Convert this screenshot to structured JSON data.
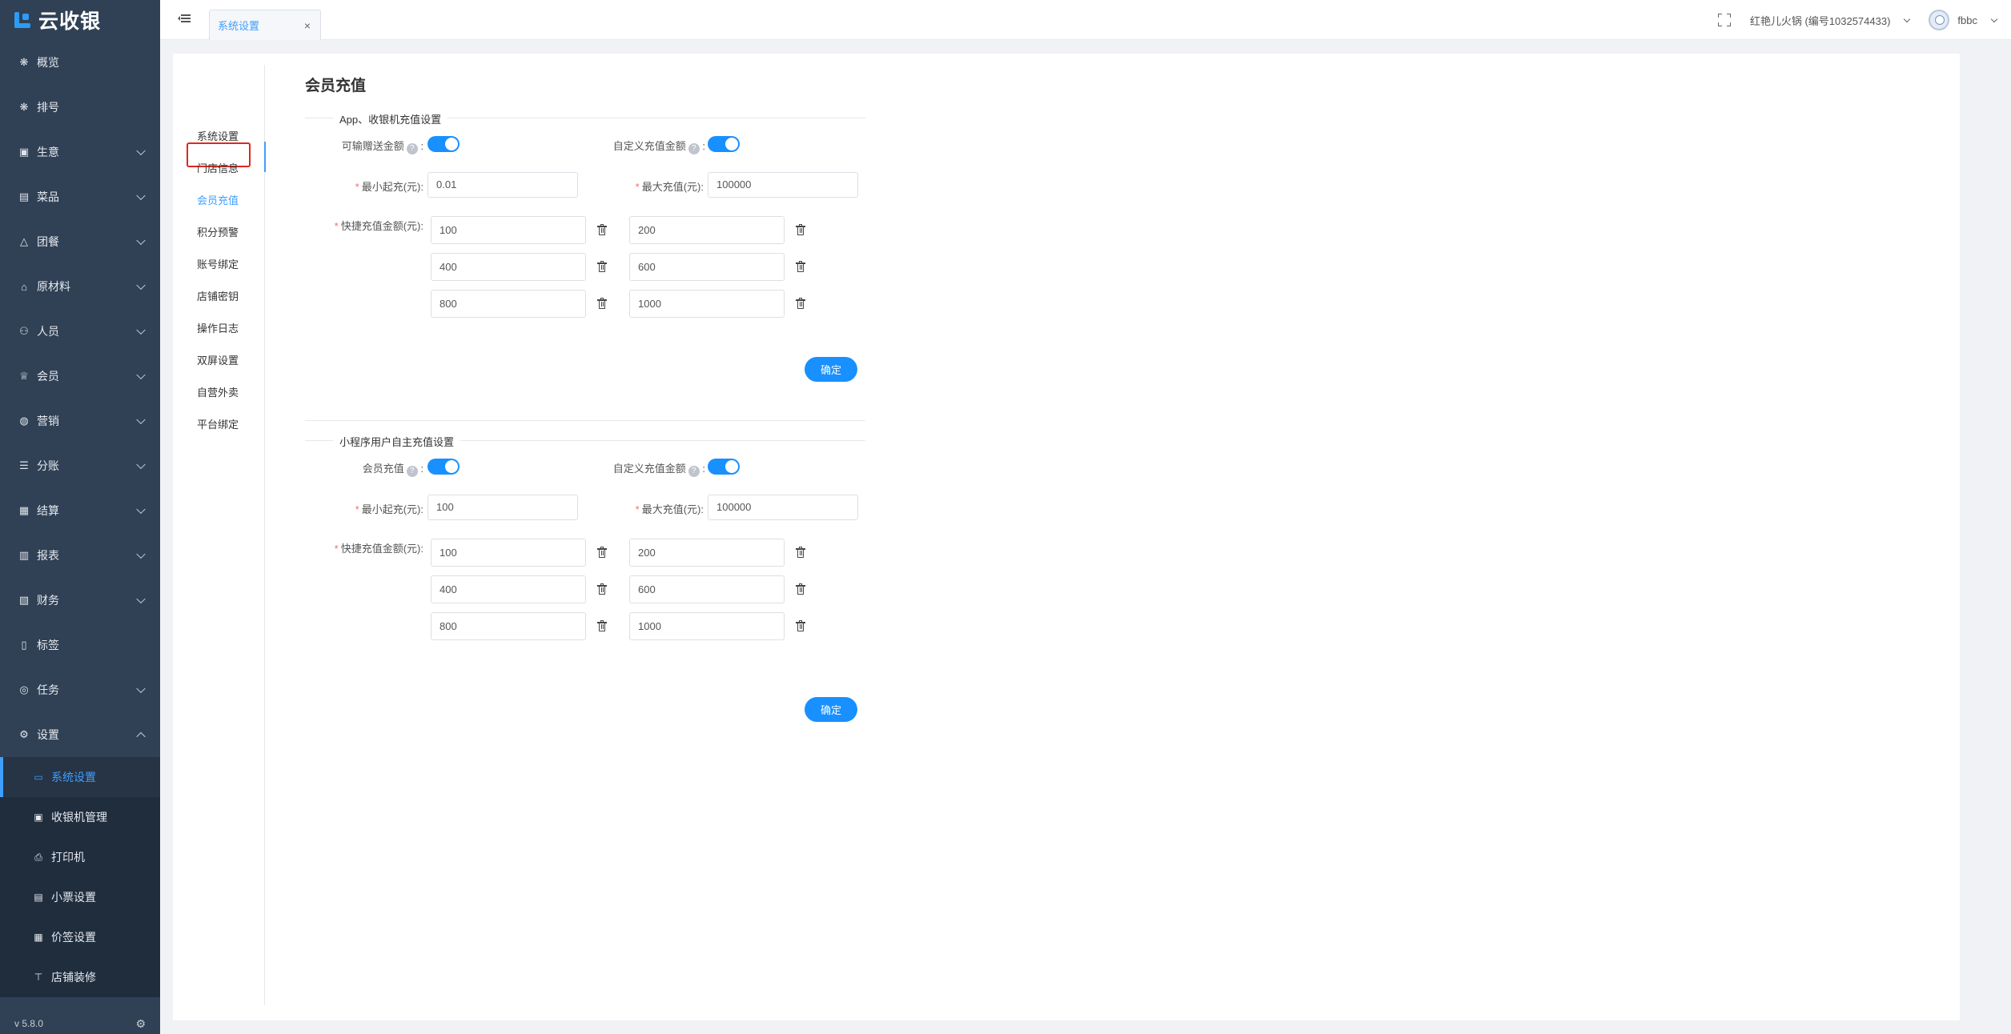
{
  "app": {
    "name": "云收银",
    "version": "v 5.8.0"
  },
  "sidebar": {
    "items": [
      {
        "label": "概览",
        "icon": "overview-icon",
        "glyph": "❋",
        "expandable": false
      },
      {
        "label": "排号",
        "icon": "queue-icon",
        "glyph": "❋",
        "expandable": false
      },
      {
        "label": "生意",
        "icon": "business-icon",
        "glyph": "▣",
        "expandable": true
      },
      {
        "label": "菜品",
        "icon": "dish-icon",
        "glyph": "▤",
        "expandable": true
      },
      {
        "label": "团餐",
        "icon": "group-meal-icon",
        "glyph": "△",
        "expandable": true
      },
      {
        "label": "原材料",
        "icon": "material-icon",
        "glyph": "⌂",
        "expandable": true
      },
      {
        "label": "人员",
        "icon": "staff-icon",
        "glyph": "⚇",
        "expandable": true
      },
      {
        "label": "会员",
        "icon": "member-icon",
        "glyph": "♕",
        "expandable": true
      },
      {
        "label": "营销",
        "icon": "marketing-icon",
        "glyph": "◍",
        "expandable": true
      },
      {
        "label": "分账",
        "icon": "split-account-icon",
        "glyph": "☰",
        "expandable": true
      },
      {
        "label": "结算",
        "icon": "settlement-icon",
        "glyph": "▦",
        "expandable": true
      },
      {
        "label": "报表",
        "icon": "report-icon",
        "glyph": "▥",
        "expandable": true
      },
      {
        "label": "财务",
        "icon": "finance-icon",
        "glyph": "▧",
        "expandable": true
      },
      {
        "label": "标签",
        "icon": "tag-icon",
        "glyph": "▯",
        "expandable": false
      },
      {
        "label": "任务",
        "icon": "task-icon",
        "glyph": "◎",
        "expandable": true
      },
      {
        "label": "设置",
        "icon": "settings-icon",
        "glyph": "⚙",
        "expandable": true,
        "expanded": true
      }
    ],
    "submenu": [
      {
        "label": "系统设置",
        "icon": "monitor-icon",
        "glyph": "▭",
        "active": true
      },
      {
        "label": "收银机管理",
        "icon": "cashier-icon",
        "glyph": "▣"
      },
      {
        "label": "打印机",
        "icon": "printer-icon",
        "glyph": "⎙"
      },
      {
        "label": "小票设置",
        "icon": "receipt-icon",
        "glyph": "▤"
      },
      {
        "label": "价签设置",
        "icon": "price-tag-icon",
        "glyph": "▦"
      },
      {
        "label": "店铺装修",
        "icon": "store-decor-icon",
        "glyph": "⊤"
      }
    ]
  },
  "header": {
    "tab_label": "系统设置",
    "tab_close": "×",
    "store_name": "红艳儿火锅 (编号1032574433)",
    "user_name": "fbbc"
  },
  "subnav": {
    "items": [
      "系统设置",
      "门店信息",
      "会员充值",
      "积分预警",
      "账号绑定",
      "店铺密钥",
      "操作日志",
      "双屏设置",
      "自营外卖",
      "平台绑定"
    ],
    "active_index": 2
  },
  "page": {
    "title": "会员充值",
    "sections": [
      {
        "title": "App、收银机充值设置",
        "toggle1_label": "可输赠送金额",
        "toggle1_on": true,
        "toggle2_label": "自定义充值金额",
        "toggle2_on": true,
        "min_label": "最小起充(元):",
        "min_value": "0.01",
        "max_label": "最大充值(元):",
        "max_value": "100000",
        "quick_label": "快捷充值金额(元):",
        "quick_amounts": [
          "100",
          "200",
          "400",
          "600",
          "800",
          "1000"
        ],
        "confirm_label": "确定"
      },
      {
        "title": "小程序用户自主充值设置",
        "toggle1_label": "会员充值",
        "toggle1_on": true,
        "toggle2_label": "自定义充值金额",
        "toggle2_on": true,
        "min_label": "最小起充(元):",
        "min_value": "100",
        "max_label": "最大充值(元):",
        "max_value": "100000",
        "quick_label": "快捷充值金额(元):",
        "quick_amounts": [
          "100",
          "200",
          "400",
          "600",
          "800",
          "1000"
        ],
        "confirm_label": "确定"
      }
    ]
  },
  "colors": {
    "sidebar_bg": "#304156",
    "accent": "#1890ff",
    "highlight_box": "#e0271f"
  }
}
